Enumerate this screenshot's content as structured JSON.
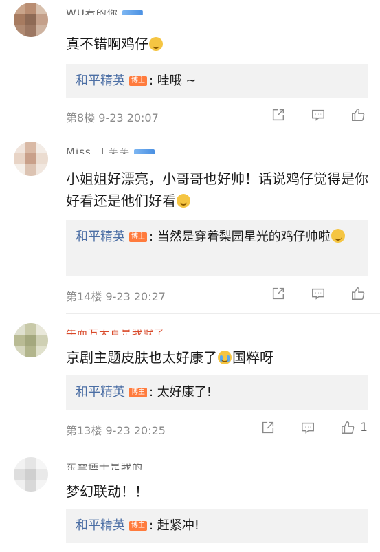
{
  "comments": [
    {
      "username": "WU看的你",
      "text": "真不错啊鸡仔",
      "reply": {
        "name": "和平精英",
        "badge": "博主",
        "text": ": 哇哦 ~"
      },
      "meta": "第8楼 9-23 20:07",
      "like_count": ""
    },
    {
      "username": "Miss_丁芙芙",
      "text": "小姐姐好漂亮，小哥哥也好帅！话说鸡仔觉得是你好看还是他们好看",
      "reply": {
        "name": "和平精英",
        "badge": "博主",
        "text": ": 当然是穿着梨园星光的鸡仔帅啦"
      },
      "meta": "第14楼 9-23 20:27",
      "like_count": ""
    },
    {
      "username": "牛而万大真是我默了",
      "text_before": "京剧主题皮肤也太好康了",
      "text_after": "国粹呀",
      "reply": {
        "name": "和平精英",
        "badge": "博主",
        "text": ": 太好康了!"
      },
      "meta": "第13楼 9-23 20:25",
      "like_count": "1"
    },
    {
      "username": "东雲博士是我的",
      "text": "梦幻联动！！",
      "reply": {
        "name": "和平精英",
        "badge": "博主",
        "text": ": 赶紧冲!"
      }
    }
  ],
  "icons": {
    "share": "share-icon",
    "comment": "comment-icon",
    "like": "thumbs-up-icon"
  },
  "colors": {
    "reply_name": "#4c6fa5",
    "badge": "#ff7b3d",
    "meta": "#8a8a8a",
    "reply_bg": "#f2f2f2"
  }
}
